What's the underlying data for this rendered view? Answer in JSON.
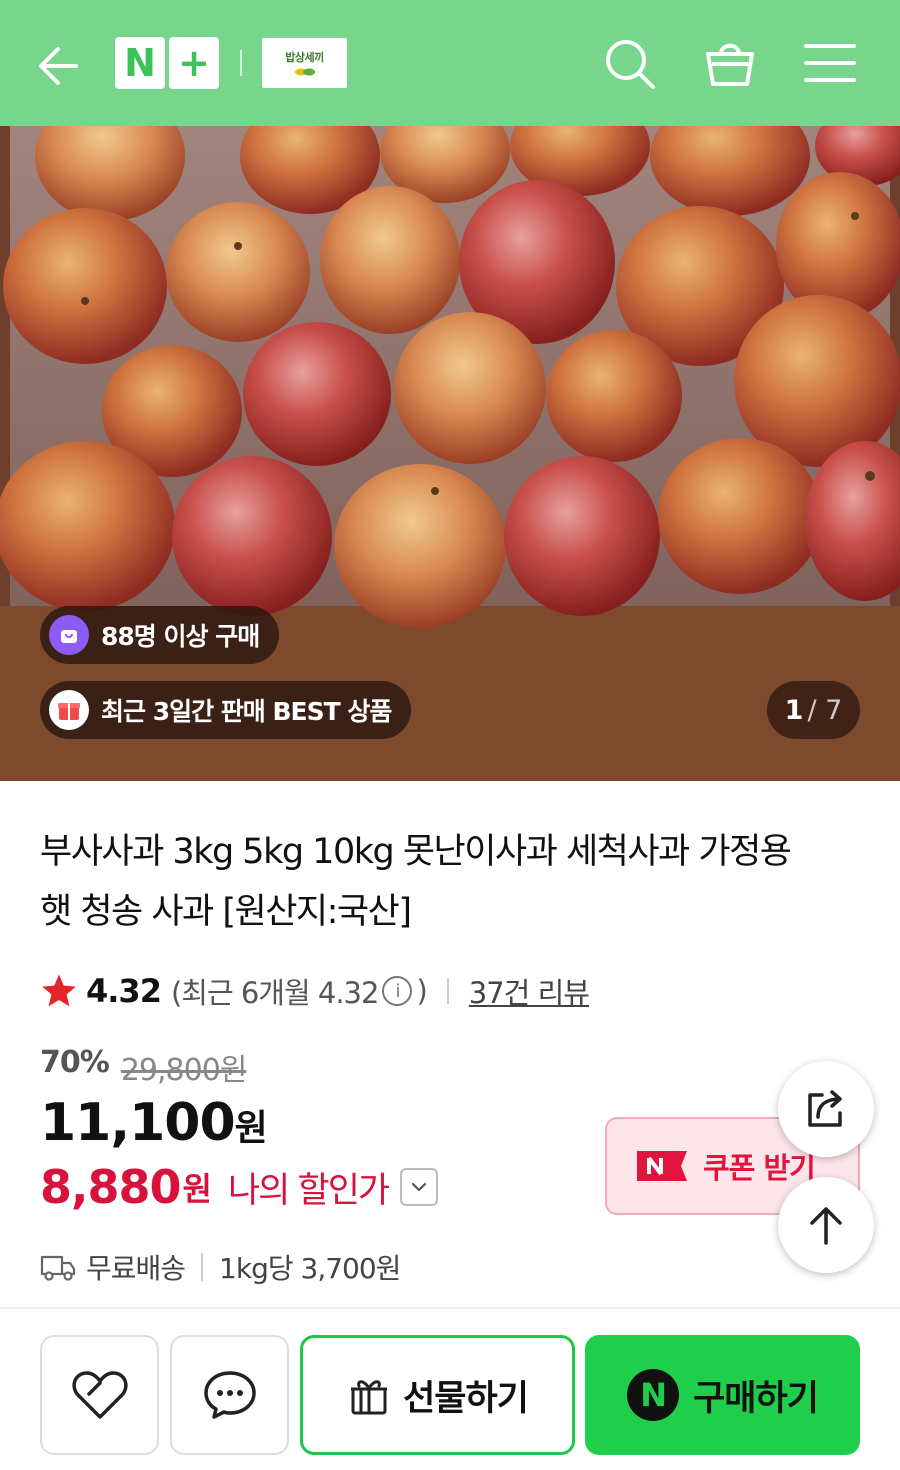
{
  "header": {
    "back_icon": "arrow-left-icon",
    "nplus_left": "N",
    "nplus_right": "+",
    "brand_name": "밥상세끼",
    "icons": [
      "search-icon",
      "cart-icon",
      "menu-icon"
    ],
    "bg_color": "#77d68b"
  },
  "hero": {
    "badge_buyers": "88명 이상 구매",
    "badge_best": "최근 3일간 판매 BEST 상품",
    "page_current": "1",
    "page_total": "/ 7"
  },
  "product": {
    "title": "부사사과 3kg 5kg 10kg 못난이사과 세척사과 가정용 햇 청송 사과 [원산지:국산]",
    "rating": "4.32",
    "rating_recent_open": "(최근 6개월 4.32",
    "rating_recent_close": ")",
    "review_count": "37건 리뷰",
    "discount_pct": "70%",
    "original_price": "29,800원",
    "price": "11,100",
    "price_unit": "원",
    "my_price": "8,880",
    "my_price_unit": "원",
    "my_price_label": "나의 할인가",
    "coupon_label": "쿠폰 받기",
    "shipping": "무료배송",
    "unit_price": "1kg당 3,700원"
  },
  "bottom_bar": {
    "gift_label": "선물하기",
    "buy_label": "구매하기",
    "npay_mark": "N"
  },
  "colors": {
    "accent_green": "#1fce4a",
    "sale_red": "#d8123d",
    "coupon_bg": "#fde6ea"
  }
}
